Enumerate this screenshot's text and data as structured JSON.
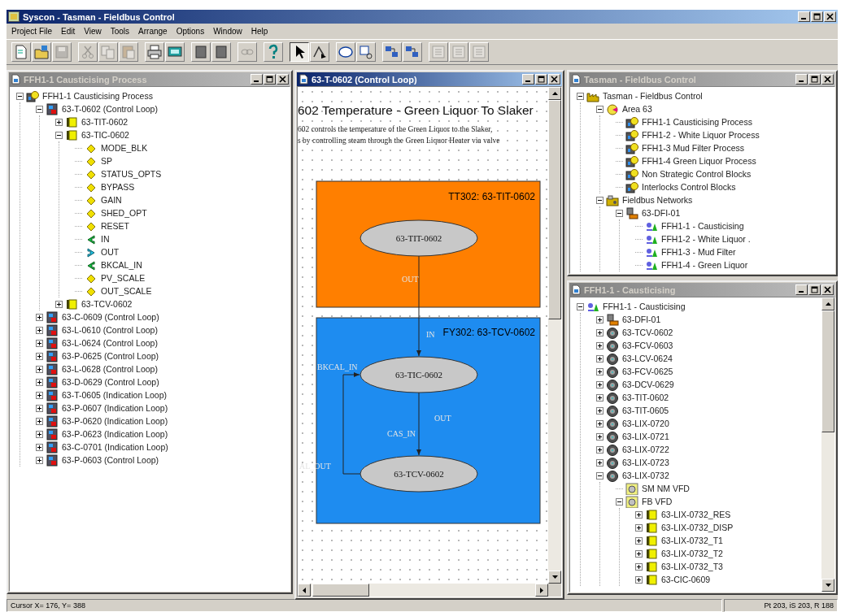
{
  "app": {
    "title": "Syscon - Tasman - Fieldbus Control"
  },
  "menu": [
    "Project File",
    "Edit",
    "View",
    "Tools",
    "Arrange",
    "Options",
    "Window",
    "Help"
  ],
  "toolbar_groups": [
    {
      "buttons": [
        {
          "kind": "new",
          "disabled": false,
          "selected": false
        },
        {
          "kind": "open",
          "disabled": false,
          "selected": false
        },
        {
          "kind": "save",
          "disabled": true,
          "selected": false
        }
      ]
    },
    {
      "buttons": [
        {
          "kind": "cut",
          "disabled": true,
          "selected": false
        },
        {
          "kind": "copy",
          "disabled": true,
          "selected": false
        },
        {
          "kind": "paste",
          "disabled": true,
          "selected": false
        }
      ]
    },
    {
      "buttons": [
        {
          "kind": "print",
          "disabled": false,
          "selected": false
        },
        {
          "kind": "preview",
          "disabled": false,
          "selected": false
        }
      ]
    },
    {
      "buttons": [
        {
          "kind": "block",
          "disabled": false,
          "selected": false
        },
        {
          "kind": "block",
          "disabled": false,
          "selected": false
        }
      ]
    },
    {
      "buttons": [
        {
          "kind": "link",
          "disabled": true,
          "selected": false
        }
      ]
    },
    {
      "buttons": [
        {
          "kind": "help",
          "disabled": false,
          "selected": false
        }
      ]
    },
    {
      "buttons": [
        {
          "kind": "pointer",
          "disabled": false,
          "selected": true
        },
        {
          "kind": "connect",
          "disabled": false,
          "selected": false
        }
      ]
    },
    {
      "buttons": [
        {
          "kind": "ellipse",
          "disabled": false,
          "selected": false
        },
        {
          "kind": "attach",
          "disabled": false,
          "selected": false
        }
      ]
    },
    {
      "buttons": [
        {
          "kind": "fblock",
          "disabled": false,
          "selected": false
        },
        {
          "kind": "fblock",
          "disabled": false,
          "selected": false
        }
      ]
    },
    {
      "buttons": [
        {
          "kind": "layout",
          "disabled": true,
          "selected": false
        },
        {
          "kind": "layout",
          "disabled": true,
          "selected": false
        },
        {
          "kind": "layout",
          "disabled": true,
          "selected": false
        }
      ]
    }
  ],
  "windows": [
    {
      "title": "FFH1-1 Causticising Process",
      "active": false,
      "kind": "tree",
      "tree": [
        {
          "label": "FFH1-1 Causticising Process",
          "kind": "process",
          "expanded": true,
          "children": [
            {
              "label": "63-T-0602 (Control Loop)",
              "kind": "loop",
              "expanded": true,
              "children": [
                {
                  "label": "63-TIT-0602",
                  "kind": "block",
                  "expanded": false
                },
                {
                  "label": "63-TIC-0602",
                  "kind": "block",
                  "expanded": true,
                  "children": [
                    {
                      "label": "MODE_BLK",
                      "kind": "param"
                    },
                    {
                      "label": "SP",
                      "kind": "param"
                    },
                    {
                      "label": "STATUS_OPTS",
                      "kind": "param"
                    },
                    {
                      "label": "BYPASS",
                      "kind": "param"
                    },
                    {
                      "label": "GAIN",
                      "kind": "param"
                    },
                    {
                      "label": "SHED_OPT",
                      "kind": "param"
                    },
                    {
                      "label": "RESET",
                      "kind": "param"
                    },
                    {
                      "label": "IN",
                      "kind": "input"
                    },
                    {
                      "label": "OUT",
                      "kind": "output"
                    },
                    {
                      "label": "BKCAL_IN",
                      "kind": "input"
                    },
                    {
                      "label": "PV_SCALE",
                      "kind": "param"
                    },
                    {
                      "label": "OUT_SCALE",
                      "kind": "param"
                    }
                  ]
                },
                {
                  "label": "63-TCV-0602",
                  "kind": "block",
                  "expanded": false
                }
              ]
            },
            {
              "label": "63-C-0609 (Control Loop)",
              "kind": "loop",
              "expanded": false
            },
            {
              "label": "63-L-0610 (Control Loop)",
              "kind": "loop",
              "expanded": false
            },
            {
              "label": "63-L-0624 (Control Loop)",
              "kind": "loop",
              "expanded": false
            },
            {
              "label": "63-P-0625 (Control Loop)",
              "kind": "loop",
              "expanded": false
            },
            {
              "label": "63-L-0628 (Control Loop)",
              "kind": "loop",
              "expanded": false
            },
            {
              "label": "63-D-0629 (Control Loop)",
              "kind": "loop",
              "expanded": false
            },
            {
              "label": "63-T-0605 (Indication Loop)",
              "kind": "loop",
              "expanded": false
            },
            {
              "label": "63-P-0607 (Indication Loop)",
              "kind": "loop",
              "expanded": false
            },
            {
              "label": "63-P-0620 (Indication Loop)",
              "kind": "loop",
              "expanded": false
            },
            {
              "label": "63-P-0623 (Indication Loop)",
              "kind": "loop",
              "expanded": false
            },
            {
              "label": "63-C-0701 (Indication Loop)",
              "kind": "loop",
              "expanded": false
            },
            {
              "label": "63-P-0603 (Control Loop)",
              "kind": "loop",
              "expanded": false
            }
          ]
        }
      ]
    },
    {
      "title": "63-T-0602 (Control Loop)",
      "active": true,
      "kind": "diagram",
      "diagram": {
        "heading": "602  Temperature - Green Liquor To Slaker",
        "description": [
          "602 controls the temperature of the Green Liquor to the Slaker,",
          "s by controlling steam through the Green Liquor Heater via valve"
        ],
        "blocks": [
          {
            "title": "TT302: 63-TIT-0602",
            "color": "#ff7f00"
          },
          {
            "title": "FY302: 63-TCV-0602",
            "color": "#1e8cf0"
          }
        ],
        "nodes": [
          "63-TIT-0602",
          "63-TIC-0602",
          "63-TCV-0602"
        ],
        "port_labels": [
          "OUT",
          "IN",
          "BKCAL_IN",
          "OUT",
          "CAS_IN",
          "AL_OUT"
        ]
      }
    },
    {
      "title": "Tasman - Fieldbus Control",
      "active": false,
      "kind": "tree",
      "tree": [
        {
          "label": "Tasman - Fieldbus Control",
          "kind": "plant",
          "expanded": true,
          "children": [
            {
              "label": "Area 63",
              "kind": "area",
              "expanded": true,
              "children": [
                {
                  "label": "FFH1-1 Causticising Process",
                  "kind": "process"
                },
                {
                  "label": "FFH1-2 - White Liquor Process",
                  "kind": "process"
                },
                {
                  "label": "FFH1-3 Mud Filter Process",
                  "kind": "process"
                },
                {
                  "label": "FFH1-4 Green Liquor Process",
                  "kind": "process"
                },
                {
                  "label": "Non Strategic Control Blocks",
                  "kind": "process"
                },
                {
                  "label": "Interlocks Control Blocks",
                  "kind": "process"
                }
              ]
            },
            {
              "label": "Fieldbus Networks",
              "kind": "network",
              "expanded": true,
              "children": [
                {
                  "label": "63-DFI-01",
                  "kind": "bridge",
                  "expanded": true,
                  "children": [
                    {
                      "label": "FFH1-1 - Causticising",
                      "kind": "channel"
                    },
                    {
                      "label": "FFH1-2 - White Liquor .",
                      "kind": "channel"
                    },
                    {
                      "label": "FFH1-3 - Mud Filter",
                      "kind": "channel"
                    },
                    {
                      "label": "FFH1-4 - Green Liquor",
                      "kind": "channel"
                    }
                  ]
                }
              ]
            }
          ]
        }
      ]
    },
    {
      "title": "FFH1-1 - Causticising",
      "active": false,
      "kind": "tree",
      "tree": [
        {
          "label": "FFH1-1 - Causticising",
          "kind": "channel",
          "expanded": true,
          "children": [
            {
              "label": "63-DFI-01",
              "kind": "bridge",
              "expanded": false
            },
            {
              "label": "63-TCV-0602",
              "kind": "device",
              "expanded": false
            },
            {
              "label": "63-FCV-0603",
              "kind": "device",
              "expanded": false
            },
            {
              "label": "63-LCV-0624",
              "kind": "device",
              "expanded": false
            },
            {
              "label": "63-FCV-0625",
              "kind": "device",
              "expanded": false
            },
            {
              "label": "63-DCV-0629",
              "kind": "device",
              "expanded": false
            },
            {
              "label": "63-TIT-0602",
              "kind": "device",
              "expanded": false
            },
            {
              "label": "63-TIT-0605",
              "kind": "device",
              "expanded": false
            },
            {
              "label": "63-LIX-0720",
              "kind": "device",
              "expanded": false
            },
            {
              "label": "63-LIX-0721",
              "kind": "device",
              "expanded": false
            },
            {
              "label": "63-LIX-0722",
              "kind": "device",
              "expanded": false
            },
            {
              "label": "63-LIX-0723",
              "kind": "device",
              "expanded": false
            },
            {
              "label": "63-LIX-0732",
              "kind": "device",
              "expanded": true,
              "children": [
                {
                  "label": "SM NM VFD",
                  "kind": "vfd"
                },
                {
                  "label": "FB VFD",
                  "kind": "vfd",
                  "expanded": true,
                  "children": [
                    {
                      "label": "63-LIX-0732_RES",
                      "kind": "block",
                      "expanded": false
                    },
                    {
                      "label": "63-LIX-0732_DISP",
                      "kind": "block",
                      "expanded": false
                    },
                    {
                      "label": "63-LIX-0732_T1",
                      "kind": "block",
                      "expanded": false
                    },
                    {
                      "label": "63-LIX-0732_T2",
                      "kind": "block",
                      "expanded": false
                    },
                    {
                      "label": "63-LIX-0732_T3",
                      "kind": "block",
                      "expanded": false
                    },
                    {
                      "label": "63-CIC-0609",
                      "kind": "block",
                      "expanded": false
                    }
                  ]
                }
              ]
            }
          ]
        }
      ]
    }
  ],
  "status_bar": {
    "cursor": "Cursor X= 176, Y= 388",
    "info": "Pt 203, iS 203, R 188"
  }
}
